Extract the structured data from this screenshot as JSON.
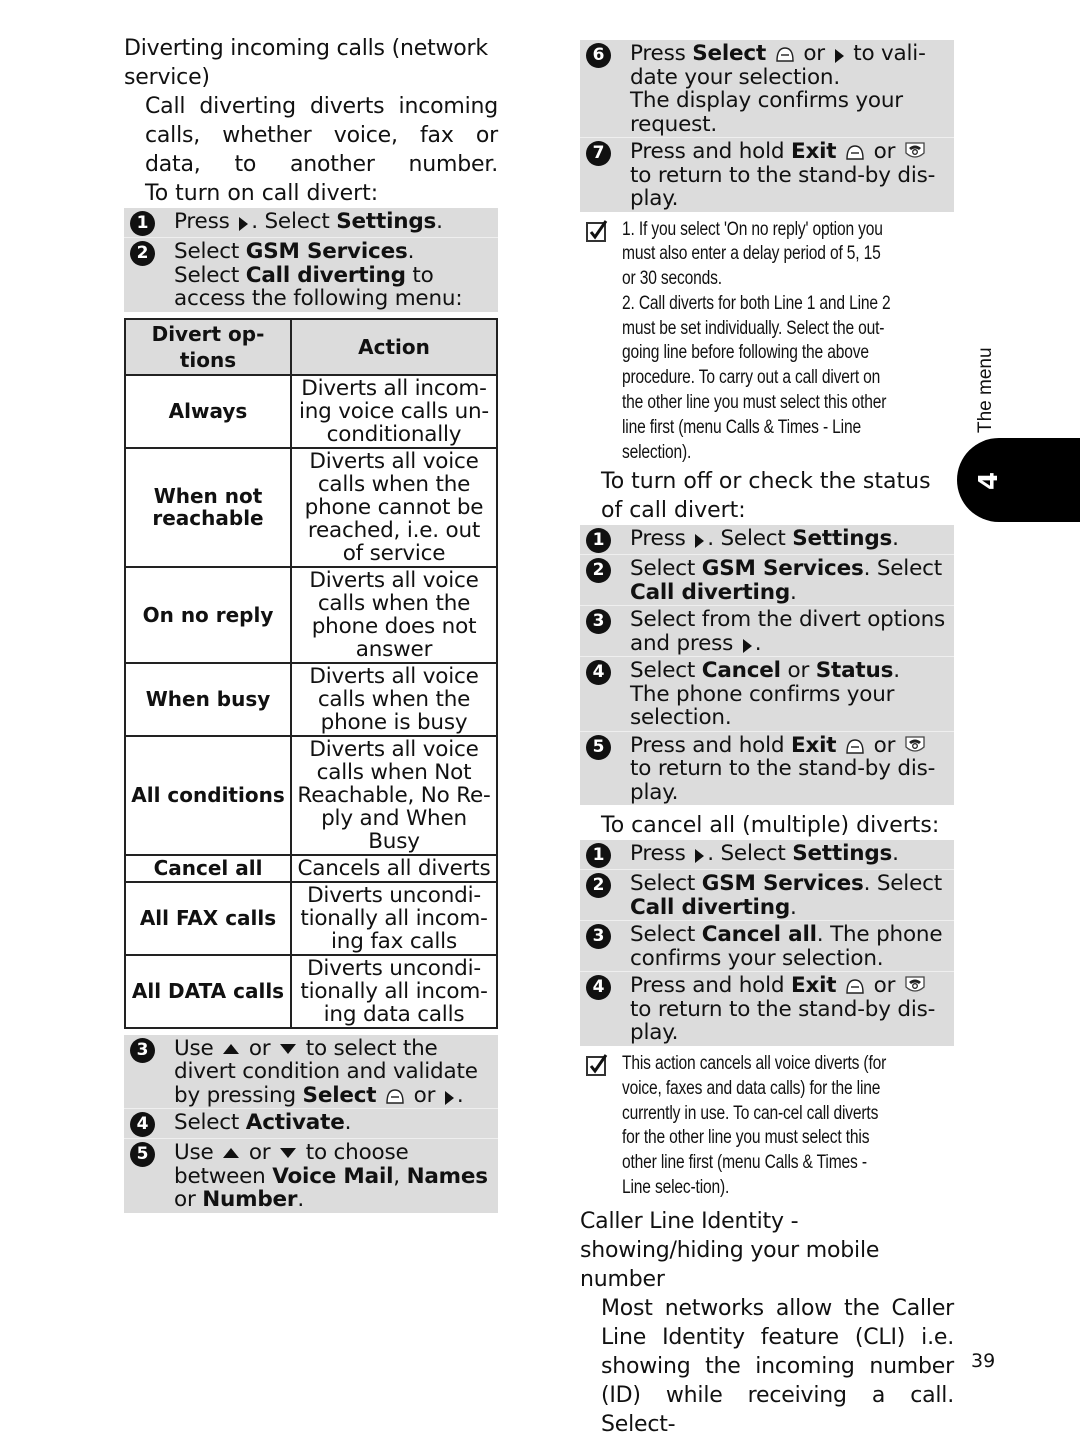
{
  "left": {
    "section_title": "Diverting incoming calls (network service)",
    "intro_para": "Call diverting diverts incoming calls, whether voice, fax or data, to another number.",
    "turn_on_label": "To turn on call divert:",
    "turn_on_steps_a": [
      {
        "num": "1",
        "parts": [
          {
            "t": "Press "
          },
          {
            "icon": "right"
          },
          {
            "t": ". Select "
          },
          {
            "b": "Settings"
          },
          {
            "t": "."
          }
        ]
      },
      {
        "num": "2",
        "parts": [
          {
            "t": "Select "
          },
          {
            "b": "GSM Services"
          },
          {
            "t": "."
          },
          {
            "br": true
          },
          {
            "t": "Select "
          },
          {
            "b": "Call diverting"
          },
          {
            "t": " to access the following menu:"
          }
        ]
      }
    ],
    "table": {
      "headers": [
        "Divert op-\ntions",
        "Action"
      ],
      "rows": [
        {
          "option": "Always",
          "action": "Diverts all incom-\ning voice calls un-\nconditionally"
        },
        {
          "option": "When not\nreachable",
          "action": "Diverts all voice\ncalls when the\nphone cannot be\nreached, i.e. out\nof service"
        },
        {
          "option": "On no reply",
          "action": "Diverts all voice\ncalls when the\nphone does not\nanswer"
        },
        {
          "option": "When busy",
          "action": "Diverts all voice\ncalls when the\nphone is busy"
        },
        {
          "option": "All conditions",
          "action": "Diverts all voice\ncalls when Not\nReachable, No Re-\nply and When\nBusy"
        },
        {
          "option": "Cancel all",
          "action": "Cancels all diverts"
        },
        {
          "option": "All FAX calls",
          "action": "Diverts uncondi-\ntionally all incom-\ning fax calls"
        },
        {
          "option": "All DATA calls",
          "action": "Diverts uncondi-\ntionally all incom-\ning data calls"
        }
      ]
    },
    "turn_on_steps_b": [
      {
        "num": "3",
        "parts": [
          {
            "t": "Use "
          },
          {
            "icon": "up"
          },
          {
            "t": " or "
          },
          {
            "icon": "down"
          },
          {
            "t": " to select the divert condition and validate by pressing "
          },
          {
            "b": "Select"
          },
          {
            "t": " "
          },
          {
            "icon": "softkey"
          },
          {
            "t": " or "
          },
          {
            "icon": "right"
          },
          {
            "t": "."
          }
        ]
      },
      {
        "num": "4",
        "parts": [
          {
            "t": "Select "
          },
          {
            "b": "Activate"
          },
          {
            "t": "."
          }
        ]
      },
      {
        "num": "5",
        "parts": [
          {
            "t": "Use "
          },
          {
            "icon": "up"
          },
          {
            "t": " or "
          },
          {
            "icon": "down"
          },
          {
            "t": " to choose between "
          },
          {
            "b": "Voice Mail"
          },
          {
            "t": ", "
          },
          {
            "b": "Names"
          },
          {
            "t": " or "
          },
          {
            "b": "Number"
          },
          {
            "t": "."
          }
        ]
      }
    ]
  },
  "right": {
    "turn_on_steps_c": [
      {
        "num": "6",
        "parts": [
          {
            "t": "Press "
          },
          {
            "b": "Select"
          },
          {
            "t": " "
          },
          {
            "icon": "softkey"
          },
          {
            "t": " or "
          },
          {
            "icon": "right"
          },
          {
            "t": " to vali-date your selection."
          },
          {
            "br": true
          },
          {
            "t": "The display confirms your request."
          }
        ]
      },
      {
        "num": "7",
        "parts": [
          {
            "t": "Press and hold "
          },
          {
            "b": "Exit"
          },
          {
            "t": " "
          },
          {
            "icon": "softkey"
          },
          {
            "t": " or "
          },
          {
            "icon": "endkey"
          },
          {
            "t": " to return to the stand-by dis-play."
          }
        ]
      }
    ],
    "note1": "1. If you select 'On no reply' option you must also enter a delay period of 5, 15 or 30 seconds.\n2. Call diverts for both Line 1 and Line 2 must be set individually. Select the out-going line before following the above procedure. To carry out a call divert on the other line you must select this other line first (menu Calls & Times - Line selection).",
    "turn_off_label": "To turn off or check the status of call divert:",
    "turn_off_steps": [
      {
        "num": "1",
        "parts": [
          {
            "t": "Press "
          },
          {
            "icon": "right"
          },
          {
            "t": ". Select "
          },
          {
            "b": "Settings"
          },
          {
            "t": "."
          }
        ]
      },
      {
        "num": "2",
        "parts": [
          {
            "t": "Select "
          },
          {
            "b": "GSM Services"
          },
          {
            "t": ". Select "
          },
          {
            "b": "Call diverting"
          },
          {
            "t": "."
          }
        ]
      },
      {
        "num": "3",
        "parts": [
          {
            "t": "Select from the divert options and press "
          },
          {
            "icon": "right"
          },
          {
            "t": "."
          }
        ]
      },
      {
        "num": "4",
        "parts": [
          {
            "t": "Select "
          },
          {
            "b": "Cancel"
          },
          {
            "t": " or "
          },
          {
            "b": "Status"
          },
          {
            "t": "."
          },
          {
            "br": true
          },
          {
            "t": "The phone confirms your selection."
          }
        ]
      },
      {
        "num": "5",
        "parts": [
          {
            "t": "Press and hold "
          },
          {
            "b": "Exit"
          },
          {
            "t": " "
          },
          {
            "icon": "softkey"
          },
          {
            "t": " or "
          },
          {
            "icon": "endkey"
          },
          {
            "t": " to return to the stand-by dis-play."
          }
        ]
      }
    ],
    "cancel_all_label": "To cancel all (multiple) diverts:",
    "cancel_all_steps": [
      {
        "num": "1",
        "parts": [
          {
            "t": "Press "
          },
          {
            "icon": "right"
          },
          {
            "t": ". Select "
          },
          {
            "b": "Settings"
          },
          {
            "t": "."
          }
        ]
      },
      {
        "num": "2",
        "parts": [
          {
            "t": "Select "
          },
          {
            "b": "GSM Services"
          },
          {
            "t": ". Select "
          },
          {
            "b": "Call diverting"
          },
          {
            "t": "."
          }
        ]
      },
      {
        "num": "3",
        "parts": [
          {
            "t": "Select "
          },
          {
            "b": "Cancel all"
          },
          {
            "t": ". The phone confirms your selection."
          }
        ]
      },
      {
        "num": "4",
        "parts": [
          {
            "t": "Press and hold "
          },
          {
            "b": "Exit"
          },
          {
            "t": " "
          },
          {
            "icon": "softkey"
          },
          {
            "t": " or "
          },
          {
            "icon": "endkey"
          },
          {
            "t": " to return to the stand-by dis-play."
          }
        ]
      }
    ],
    "note2": "This action cancels all voice diverts (for voice, faxes and data calls) for the line currently in use. To can-cel call diverts for the other line you must select this other line first (menu Calls & Times - Line selec-tion).",
    "cli_title": "Caller Line Identity - showing/hiding your mobile number",
    "cli_para": "Most networks allow the Caller Line Identity feature (CLI) i.e. showing the incoming number (ID) while receiving a call. Select-"
  },
  "side": {
    "section_label": "The menu",
    "chapter_number": "4"
  },
  "page_number": "39",
  "icons": {
    "right": "right-arrow-key-icon",
    "up": "up-arrow-key-icon",
    "down": "down-arrow-key-icon",
    "softkey": "soft-key-icon",
    "endkey": "end-call-key-icon",
    "note": "checkbox-note-icon"
  },
  "colors": {
    "step_background": "#dcdcdc",
    "text": "#111111",
    "chapter_tab": "#000000"
  }
}
